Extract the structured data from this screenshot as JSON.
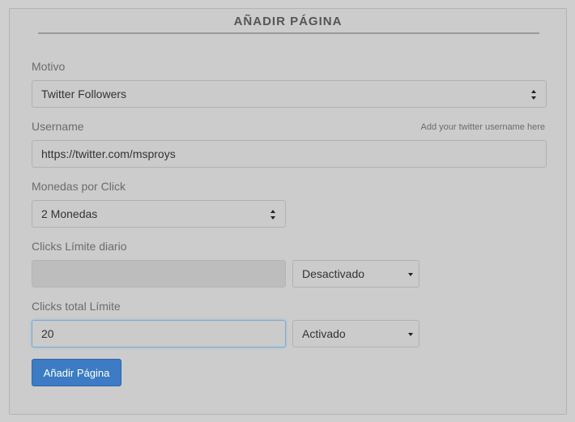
{
  "form": {
    "title": "AÑADIR PÁGINA",
    "motivo": {
      "label": "Motivo",
      "value": "Twitter Followers"
    },
    "username": {
      "label": "Username",
      "hint": "Add your twitter username here",
      "value": "https://twitter.com/msproys"
    },
    "monedas": {
      "label": "Monedas por Click",
      "value": "2 Monedas"
    },
    "daily_limit": {
      "label": "Clicks Límite diario",
      "value": "",
      "status": "Desactivado"
    },
    "total_limit": {
      "label": "Clicks total Límite",
      "value": "20",
      "status": "Activado"
    },
    "submit_label": "Añadir Página"
  }
}
